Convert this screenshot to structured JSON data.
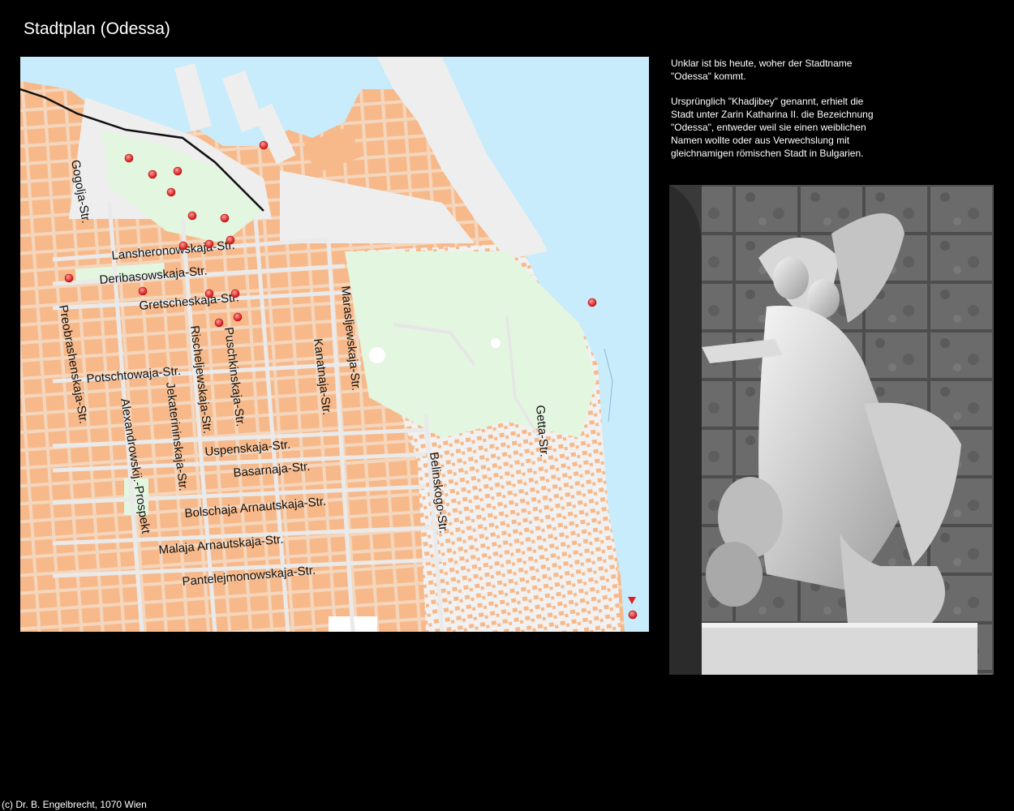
{
  "page": {
    "title": "Stadtplan (Odessa)",
    "copyright": "(c) Dr. B. Engelbrecht, 1070 Wien"
  },
  "description": {
    "paragraph_1": "Unklar ist bis heute, woher der Stadtname \"Odessa\" kommt.",
    "paragraph_2": "Ursprünglich \"Khadjibey\" genannt, erhielt die Stadt unter Zarin Katharina II. die Bezeichnung \"Odessa\", entweder weil sie einen weiblichen Namen wollte oder aus Verwechslung mit gleichnamigen römischen Stadt in Bulgarien."
  },
  "map": {
    "colors": {
      "sea": "#c8ecfb",
      "blocks": "#f7b98a",
      "land": "#f4d6bd",
      "park": "#e3f6e0",
      "roads": "#e6e6e6",
      "marker": "#e02020"
    },
    "streets": {
      "gogolja": "Gogolja-Str.",
      "lansheronowskaja": "Lansheronowskaja-Str.",
      "deribasowskaja": "Deribasowskaja-Str.",
      "gretscheskaja": "Gretscheskaja-Str.",
      "preobrashenskaja": "Preobrashenskaja-Str.",
      "potschtowaja": "Potschtowaja-Str.",
      "alexandrowskij": "Alexandrowskij.-Prospekt",
      "jekaterininskaja": "Jekaterininskaja-Str.",
      "rischeljewskaja": "Rischeljewskaja-Str.",
      "puschkinskaja": "Puschkinskaja-Str.",
      "kanatnaja": "Kanatnaja-Str.",
      "marasljewskaja": "Marasljewskaja-Str.",
      "uspenskaja": "Uspenskaja-Str.",
      "basarnaja": "Basarnaja-Str.",
      "bolschaja_arnautskaja": "Bolschaja Arnautskaja-Str.",
      "malaja_arnautskaja": "Malaja Arnautskaja-Str.",
      "pantelejmonowskaja": "Pantelejmonowskaja-Str.",
      "belinskogo": "Belinskogo-Str.",
      "getta": "Getta-Str."
    },
    "markers": [
      "poi-marker",
      "poi-marker",
      "poi-marker",
      "poi-marker",
      "poi-marker",
      "poi-marker",
      "poi-marker",
      "poi-marker",
      "poi-marker",
      "poi-marker",
      "poi-marker",
      "poi-marker",
      "poi-marker",
      "poi-marker",
      "poi-marker",
      "poi-marker",
      "poi-marker",
      "poi-marker"
    ]
  },
  "photo": {
    "subject": "marble-statue-group-photo"
  }
}
